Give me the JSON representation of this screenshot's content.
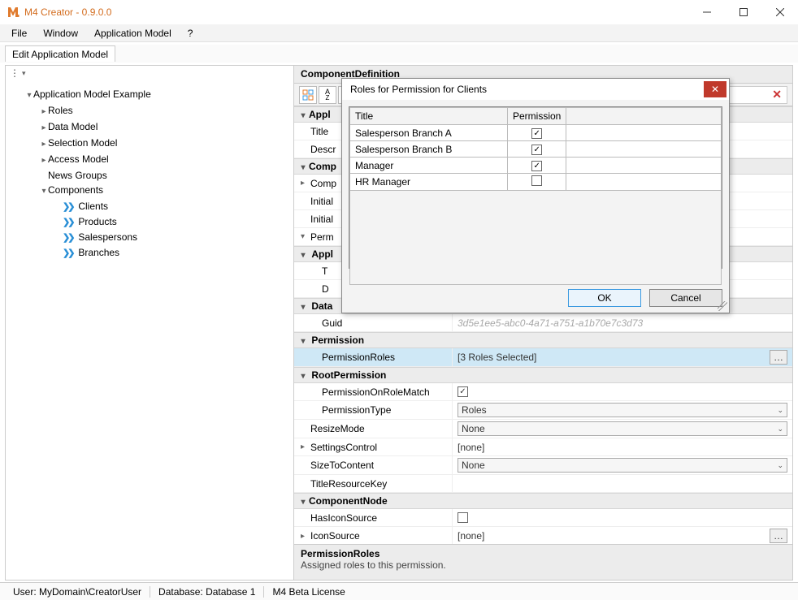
{
  "window": {
    "title": "M4 Creator - 0.9.0.0"
  },
  "menu": {
    "file": "File",
    "window": "Window",
    "appmodel": "Application Model",
    "help": "?"
  },
  "tab": {
    "label": "Edit Application Model"
  },
  "tree": {
    "root": "Application Model Example",
    "roles": "Roles",
    "datamodel": "Data Model",
    "selectionmodel": "Selection Model",
    "accessmodel": "Access Model",
    "newsgroups": "News Groups",
    "components": "Components",
    "comp": {
      "clients": "Clients",
      "products": "Products",
      "salespersons": "Salespersons",
      "branches": "Branches"
    }
  },
  "panel": {
    "header": "ComponentDefinition"
  },
  "props": {
    "cat_app": "Appl",
    "title_k": "Title",
    "descr_k": "Descr",
    "cat_comp": "Comp",
    "comp_k": "Comp",
    "init_k": "Initial",
    "init2_k": "Initial",
    "perm_k": "Perm",
    "cat_app2": "Appl",
    "t_k": "T",
    "d_k": "D",
    "cat_data": "Data",
    "guid_k": "Guid",
    "guid_v": "3d5e1ee5-abc0-4a71-a751-a1b70e7c3d73",
    "cat_permission": "Permission",
    "permissionroles_k": "PermissionRoles",
    "permissionroles_v": "[3 Roles Selected]",
    "cat_rootperm": "RootPermission",
    "ponrm_k": "PermissionOnRoleMatch",
    "ptype_k": "PermissionType",
    "ptype_v": "Roles",
    "resize_k": "ResizeMode",
    "resize_v": "None",
    "settings_k": "SettingsControl",
    "settings_v": "[none]",
    "stc_k": "SizeToContent",
    "stc_v": "None",
    "trk_k": "TitleResourceKey",
    "cat_compnode": "ComponentNode",
    "hasicon_k": "HasIconSource",
    "iconsrc_k": "IconSource",
    "iconsrc_v": "[none]"
  },
  "desc": {
    "title": "PermissionRoles",
    "text": "Assigned roles to this permission."
  },
  "dialog": {
    "title": "Roles for Permission for Clients",
    "col_title": "Title",
    "col_perm": "Permission",
    "rows": [
      {
        "title": "Salesperson Branch A",
        "checked": true
      },
      {
        "title": "Salesperson Branch B",
        "checked": true
      },
      {
        "title": "Manager",
        "checked": true
      },
      {
        "title": "HR Manager",
        "checked": false
      }
    ],
    "ok": "OK",
    "cancel": "Cancel"
  },
  "status": {
    "user": "User: MyDomain\\CreatorUser",
    "db": "Database: Database 1",
    "lic": "M4 Beta License"
  }
}
